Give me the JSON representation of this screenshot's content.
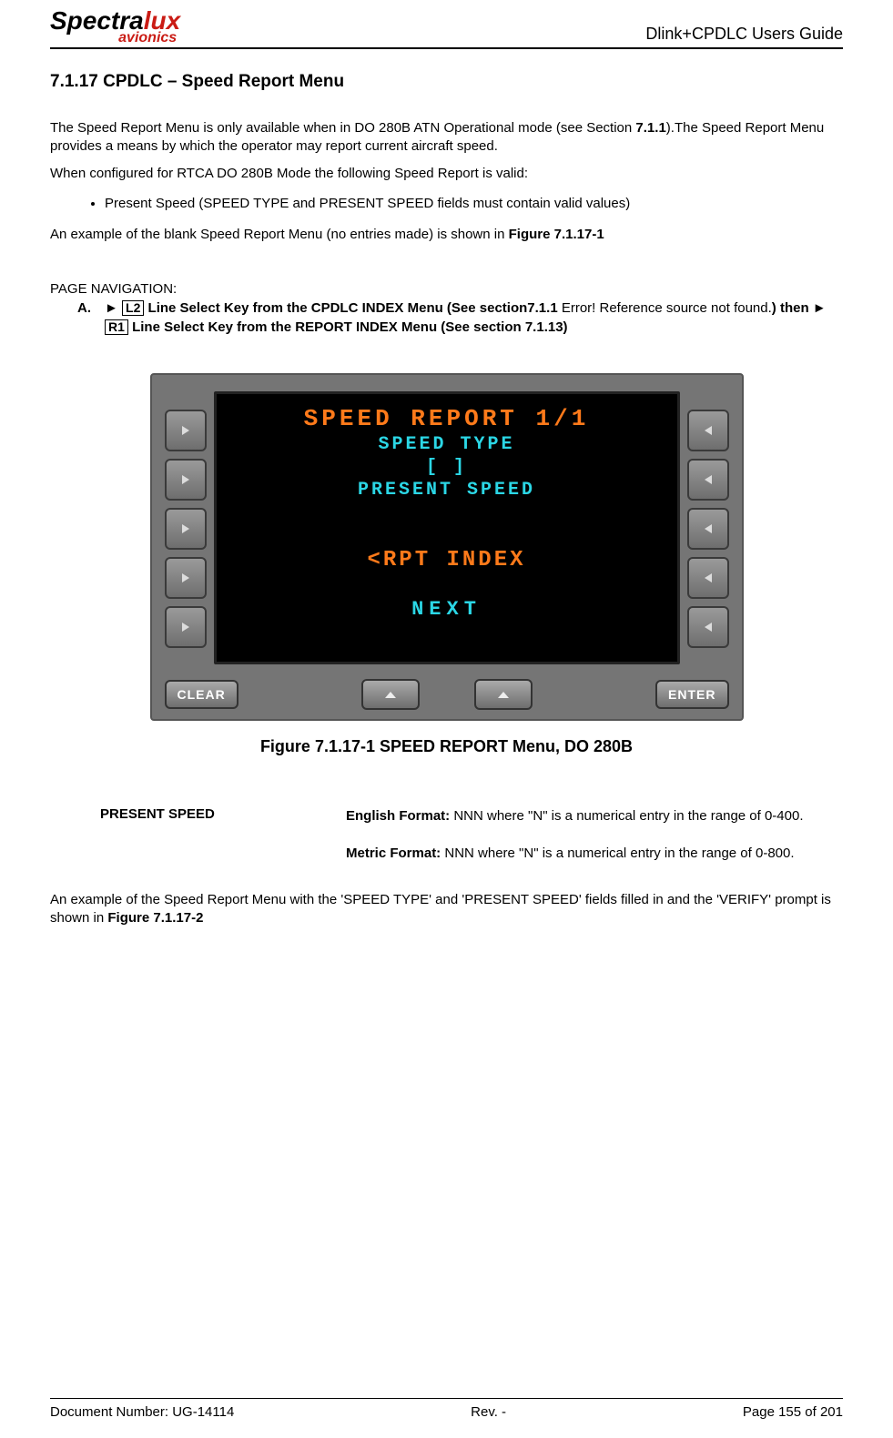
{
  "header": {
    "logo_line1a": "Spectra",
    "logo_line1b": "lux",
    "logo_line2": "avionics",
    "doc_title": "Dlink+CPDLC Users Guide"
  },
  "section": {
    "number": "7.1.17",
    "title": "CPDLC – Speed Report Menu"
  },
  "body": {
    "p1a": "The Speed Report Menu is only available when in DO 280B ATN Operational mode (see Section ",
    "p1b": "7.1.1",
    "p1c": ").The Speed Report Menu provides a means by which the operator may report current aircraft speed.",
    "p2": "When configured for RTCA DO 280B Mode the following Speed Report is valid:",
    "bullet1": "Present Speed (SPEED TYPE and PRESENT SPEED fields must contain valid values)",
    "p3a": "An example of the blank Speed Report Menu (no entries made) is shown in ",
    "p3b": "Figure 7.1.17-1",
    "nav_label": "PAGE NAVIGATION:",
    "nav_letter": "A.",
    "nav_arrow": "►",
    "nav_key1": "L2",
    "nav_text1": " Line Select Key from the CPDLC INDEX Menu (See section7.1.1 ",
    "nav_error": "Error! Reference source not found.",
    "nav_text2": ") then ► ",
    "nav_key2": "R1",
    "nav_text3": " Line Select Key from the REPORT INDEX Menu (See section 7.1.13)"
  },
  "mcdu": {
    "title": "SPEED REPORT  1/1",
    "line1": "SPEED TYPE",
    "line2": "[   ]",
    "line3": "PRESENT SPEED",
    "line4": "<RPT INDEX",
    "next": "NEXT",
    "clear": "CLEAR",
    "enter": "ENTER"
  },
  "figure_caption": "Figure 7.1.17-1 SPEED REPORT Menu, DO 280B",
  "def": {
    "label": "PRESENT SPEED",
    "eng_label": "English Format: ",
    "eng_text": "NNN where \"N\" is a numerical entry in the range of 0-400.",
    "met_label": "Metric Format: ",
    "met_text": "NNN where \"N\" is a numerical entry in the range of 0-800."
  },
  "p_after": {
    "a": "An example of the Speed Report Menu with the 'SPEED TYPE' and 'PRESENT SPEED' fields filled in and the 'VERIFY' prompt is shown in ",
    "b": "Figure 7.1.17-2"
  },
  "footer": {
    "doc_num": "Document Number:  UG-14114",
    "rev": "Rev. -",
    "page": "Page 155 of 201"
  }
}
